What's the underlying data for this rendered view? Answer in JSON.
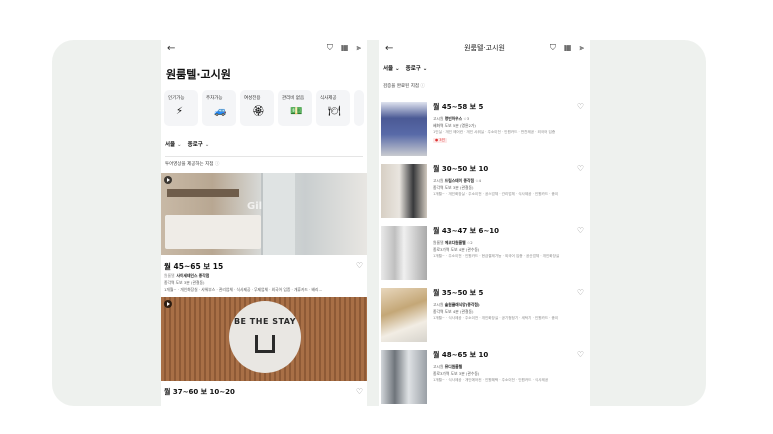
{
  "left": {
    "title": "원룸텔·고시원",
    "chips": [
      {
        "label": "인기가능",
        "icon": "⚡"
      },
      {
        "label": "주차가능",
        "icon": "🚙"
      },
      {
        "label": "여성전용",
        "icon": "🏵"
      },
      {
        "label": "관리비 없음",
        "icon": "💵"
      },
      {
        "label": "식사제공",
        "icon": "🍽"
      }
    ],
    "filter_city": "서울",
    "filter_district": "종로구",
    "section_label": "투어영상을 제공하는 지점",
    "hero": {
      "watermark": "Gil",
      "price": "월 45~65  보 15",
      "type": "원룸텔",
      "name": "사이세테인스 종각점",
      "walk": "종각역 도보 3분 (관철동)",
      "options": "1개월~ · 개인화장실 · 샤워부스 · 관리업체 · 식사제공 · 무제업체 · 외국어 입증 · 개휴카드 · 배리…"
    },
    "hero2_sign": "BE THE STAY",
    "bottom_price": "월 37~60  보 10~20"
  },
  "right": {
    "header_title": "원룸텔·고시원",
    "filter_city": "서울",
    "filter_district": "종로구",
    "section_label": "검증을 완료된 지점",
    "listings": [
      {
        "price": "월 45~58  보 5",
        "type": "고시원",
        "name": "명빈하우스",
        "rating": "3",
        "walk": "혜화역 도보 5분 (명륜2가)",
        "options": "1인실 · 개인 에어컨 · 개인 샤워실 · 주소이전 · 인원카드 · 반찬제공 · 외국어 입증",
        "badge": "● 3인"
      },
      {
        "price": "월 30~50  보 10",
        "type": "고시원",
        "name": "드림스테이 종각점",
        "rating": "4",
        "walk": "종각역 도보 3분 (관철동)",
        "options": "1개월~ · 개인화장실 · 주소이전 · 공스업체 · 관리업체 · 식사제공 · 인원카드 · 종이"
      },
      {
        "price": "월 43~47  보 6~10",
        "type": "원룸텔",
        "name": "에코다원룸텔",
        "rating": "2",
        "walk": "종로3가역 도보 4분 (관수동)",
        "options": "1개월~ · 주소이전 · 인원카드 · 현금결제가능 · 외국어 입증 · 공산업체 · 개인화장실"
      },
      {
        "price": "월 35~50  보 5",
        "type": "고시원",
        "name": "솔원클래식양(종각점)",
        "rating": "",
        "walk": "종각역 도보 4분 (관철동)",
        "options": "1개월~ · 식사제공 · 주소이전 · 개인화장실 · 공기청정기 · 세탁기 · 인원카드 · 종이"
      },
      {
        "price": "월 48~65  보 10",
        "type": "고시원",
        "name": "뮤디원룸텔",
        "rating": "",
        "walk": "종로3가역 도보 3분 (관수동)",
        "options": "1개월~ · 식사제공 · 개인에어컨 · 인원혜택 · 주소이전 · 인원카드 · 식사제공"
      }
    ]
  }
}
